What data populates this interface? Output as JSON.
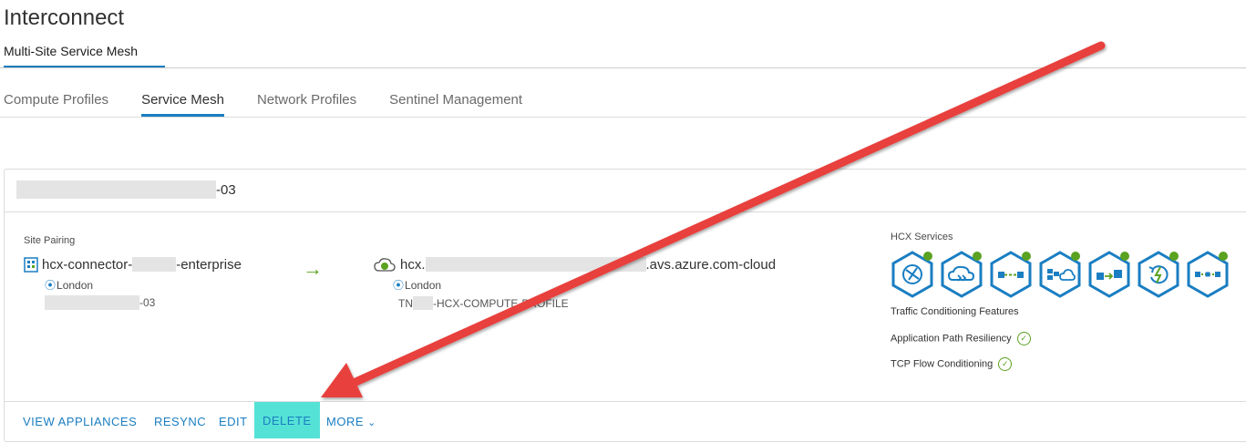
{
  "app": {
    "title": "Interconnect",
    "top_tab": "Multi-Site Service Mesh"
  },
  "tabs": [
    {
      "label": "Compute Profiles"
    },
    {
      "label": "Service Mesh",
      "active": true
    },
    {
      "label": "Network Profiles"
    },
    {
      "label": "Sentinel Management"
    }
  ],
  "mesh": {
    "name_suffix": "-03",
    "site_pairing_label": "Site Pairing",
    "source": {
      "name_prefix": "hcx-connector-",
      "name_suffix": "-enterprise",
      "location": "London",
      "profile_suffix": "-03"
    },
    "destination": {
      "name_prefix": "hcx.",
      "name_suffix": ".avs.azure.com-cloud",
      "location": "London",
      "profile_prefix": "TN",
      "profile_suffix": "-HCX-COMPUTE-PROFILE"
    },
    "arrow": "→",
    "hcx_services_label": "HCX Services",
    "services": [
      {
        "icon": "interconnect-icon"
      },
      {
        "icon": "wan-optimization-icon"
      },
      {
        "icon": "network-extension-icon"
      },
      {
        "icon": "bulk-migration-icon"
      },
      {
        "icon": "vmotion-migration-icon"
      },
      {
        "icon": "disaster-recovery-icon"
      },
      {
        "icon": "mobility-optimized-networking-icon"
      }
    ],
    "traffic_label": "Traffic Conditioning Features",
    "features": [
      {
        "label": "Application Path Resiliency"
      },
      {
        "label": "TCP Flow Conditioning"
      }
    ]
  },
  "actions": {
    "view_appliances": "VIEW APPLIANCES",
    "resync": "RESYNC",
    "edit": "EDIT",
    "delete": "DELETE",
    "more": "MORE",
    "more_chevron": "⌄"
  },
  "colors": {
    "accent": "#1a7ec2",
    "service_icon": "#1a7ec2",
    "status_ok": "#5aa220",
    "delete_highlight": "#55e2d6",
    "annotation_arrow": "#e8413d"
  }
}
